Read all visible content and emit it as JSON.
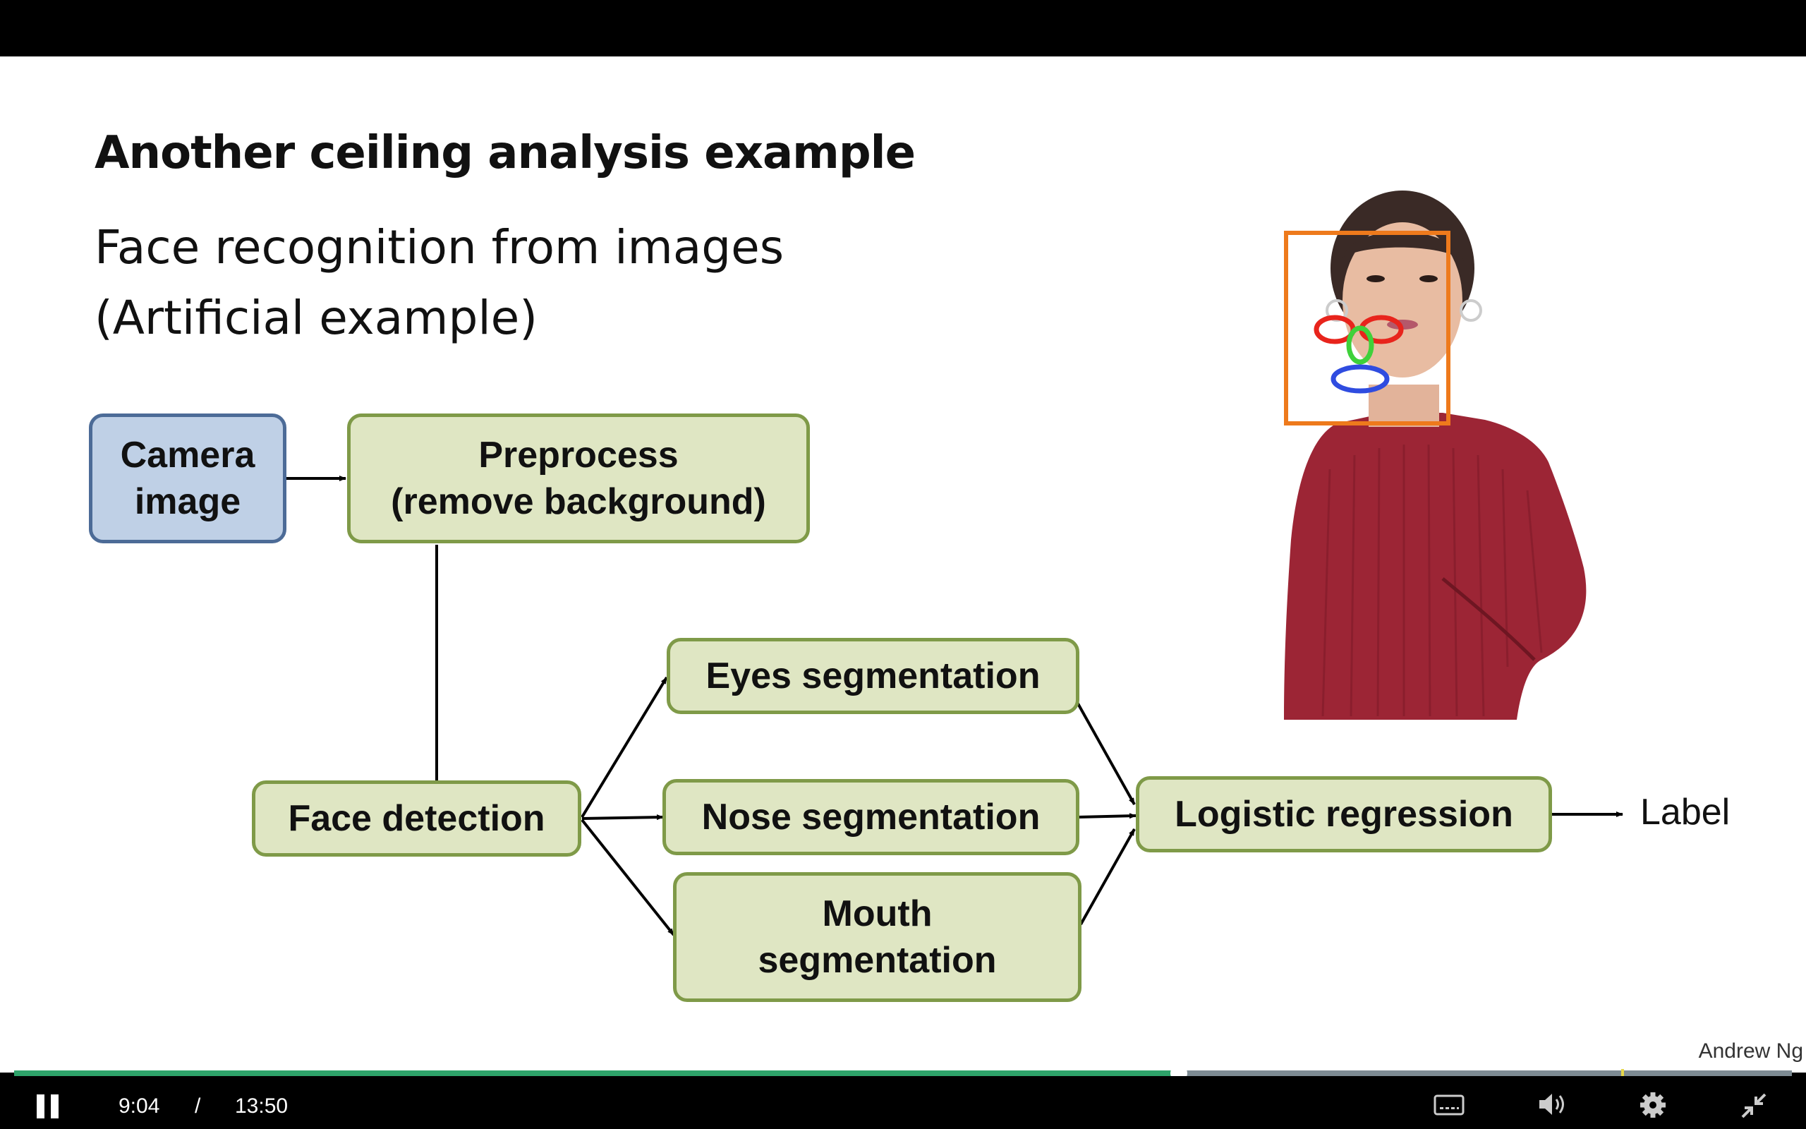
{
  "slide": {
    "title": "Another ceiling analysis example",
    "subtitle_line1": "Face recognition from images",
    "subtitle_line2": "(Artificial example)",
    "label": "Label",
    "watermark": "Andrew Ng"
  },
  "diagram": {
    "nodes": {
      "camera": "Camera\nimage",
      "preprocess": "Preprocess\n(remove background)",
      "face_detection": "Face detection",
      "eyes": "Eyes segmentation",
      "nose": "Nose segmentation",
      "mouth": "Mouth\nsegmentation",
      "logistic": "Logistic regression"
    },
    "colors": {
      "green_fill": "#dfe6c3",
      "green_border": "#7f9a48",
      "blue_fill": "#bfd0e6",
      "blue_border": "#4c6b97"
    }
  },
  "player": {
    "current_time": "9:04",
    "separator": "/",
    "total_time": "13:50",
    "progress_played": 0.6553,
    "progress_buffered": 1.0,
    "marker_position": 0.904,
    "icons": {
      "play_pause": "pause-icon",
      "captions": "captions-icon",
      "volume": "volume-icon",
      "settings": "gear-icon",
      "exit_fullscreen": "exit-fullscreen-icon"
    },
    "colors": {
      "played": "#2ea36a",
      "buffered": "#7d8b93",
      "marker": "#e5d64a"
    }
  }
}
